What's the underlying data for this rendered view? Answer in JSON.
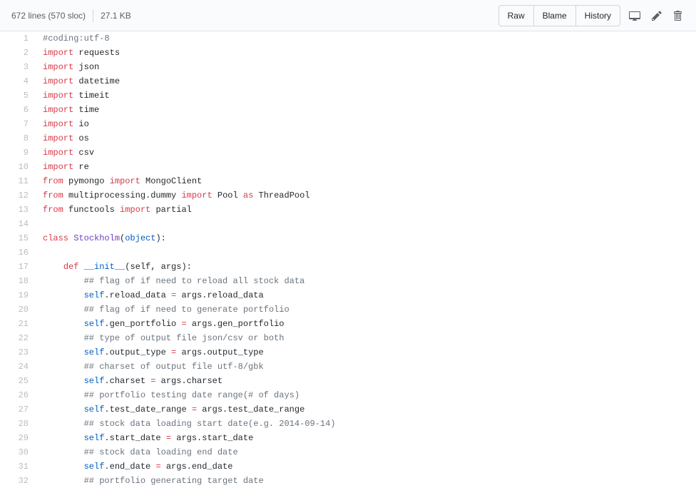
{
  "header": {
    "lines_info": "672 lines (570 sloc)",
    "size_info": "27.1 KB",
    "raw_label": "Raw",
    "blame_label": "Blame",
    "history_label": "History"
  },
  "code": {
    "lines": [
      {
        "n": 1,
        "tokens": [
          {
            "t": "#coding:utf-8",
            "c": "pl-c"
          }
        ]
      },
      {
        "n": 2,
        "tokens": [
          {
            "t": "import",
            "c": "pl-k"
          },
          {
            "t": " requests"
          }
        ]
      },
      {
        "n": 3,
        "tokens": [
          {
            "t": "import",
            "c": "pl-k"
          },
          {
            "t": " json"
          }
        ]
      },
      {
        "n": 4,
        "tokens": [
          {
            "t": "import",
            "c": "pl-k"
          },
          {
            "t": " datetime"
          }
        ]
      },
      {
        "n": 5,
        "tokens": [
          {
            "t": "import",
            "c": "pl-k"
          },
          {
            "t": " timeit"
          }
        ]
      },
      {
        "n": 6,
        "tokens": [
          {
            "t": "import",
            "c": "pl-k"
          },
          {
            "t": " time"
          }
        ]
      },
      {
        "n": 7,
        "tokens": [
          {
            "t": "import",
            "c": "pl-k"
          },
          {
            "t": " io"
          }
        ]
      },
      {
        "n": 8,
        "tokens": [
          {
            "t": "import",
            "c": "pl-k"
          },
          {
            "t": " os"
          }
        ]
      },
      {
        "n": 9,
        "tokens": [
          {
            "t": "import",
            "c": "pl-k"
          },
          {
            "t": " csv"
          }
        ]
      },
      {
        "n": 10,
        "tokens": [
          {
            "t": "import",
            "c": "pl-k"
          },
          {
            "t": " re"
          }
        ]
      },
      {
        "n": 11,
        "tokens": [
          {
            "t": "from",
            "c": "pl-k"
          },
          {
            "t": " pymongo "
          },
          {
            "t": "import",
            "c": "pl-k"
          },
          {
            "t": " MongoClient"
          }
        ]
      },
      {
        "n": 12,
        "tokens": [
          {
            "t": "from",
            "c": "pl-k"
          },
          {
            "t": " multiprocessing.dummy "
          },
          {
            "t": "import",
            "c": "pl-k"
          },
          {
            "t": " Pool "
          },
          {
            "t": "as",
            "c": "pl-k"
          },
          {
            "t": " ThreadPool"
          }
        ]
      },
      {
        "n": 13,
        "tokens": [
          {
            "t": "from",
            "c": "pl-k"
          },
          {
            "t": " functools "
          },
          {
            "t": "import",
            "c": "pl-k"
          },
          {
            "t": " partial"
          }
        ]
      },
      {
        "n": 14,
        "tokens": []
      },
      {
        "n": 15,
        "tokens": [
          {
            "t": "class",
            "c": "pl-k"
          },
          {
            "t": " "
          },
          {
            "t": "Stockholm",
            "c": "pl-en"
          },
          {
            "t": "("
          },
          {
            "t": "object",
            "c": "pl-sf"
          },
          {
            "t": "):"
          }
        ]
      },
      {
        "n": 16,
        "tokens": []
      },
      {
        "n": 17,
        "tokens": [
          {
            "t": "    "
          },
          {
            "t": "def",
            "c": "pl-k"
          },
          {
            "t": " "
          },
          {
            "t": "__init__",
            "c": "pl-sf"
          },
          {
            "t": "("
          },
          {
            "t": "self",
            "c": "pl-smi"
          },
          {
            "t": ", "
          },
          {
            "t": "args",
            "c": "pl-smi"
          },
          {
            "t": "):"
          }
        ]
      },
      {
        "n": 18,
        "tokens": [
          {
            "t": "        "
          },
          {
            "t": "## flag of if need to reload all stock data",
            "c": "pl-c"
          }
        ]
      },
      {
        "n": 19,
        "tokens": [
          {
            "t": "        "
          },
          {
            "t": "self",
            "c": "pl-sf"
          },
          {
            "t": ".reload_data "
          },
          {
            "t": "=",
            "c": "pl-k"
          },
          {
            "t": " args.reload_data"
          }
        ]
      },
      {
        "n": 20,
        "tokens": [
          {
            "t": "        "
          },
          {
            "t": "## flag of if need to generate portfolio",
            "c": "pl-c"
          }
        ]
      },
      {
        "n": 21,
        "tokens": [
          {
            "t": "        "
          },
          {
            "t": "self",
            "c": "pl-sf"
          },
          {
            "t": ".gen_portfolio "
          },
          {
            "t": "=",
            "c": "pl-k"
          },
          {
            "t": " args.gen_portfolio"
          }
        ]
      },
      {
        "n": 22,
        "tokens": [
          {
            "t": "        "
          },
          {
            "t": "## type of output file json/csv or both",
            "c": "pl-c"
          }
        ]
      },
      {
        "n": 23,
        "tokens": [
          {
            "t": "        "
          },
          {
            "t": "self",
            "c": "pl-sf"
          },
          {
            "t": ".output_type "
          },
          {
            "t": "=",
            "c": "pl-k"
          },
          {
            "t": " args.output_type"
          }
        ]
      },
      {
        "n": 24,
        "tokens": [
          {
            "t": "        "
          },
          {
            "t": "## charset of output file utf-8/gbk",
            "c": "pl-c"
          }
        ]
      },
      {
        "n": 25,
        "tokens": [
          {
            "t": "        "
          },
          {
            "t": "self",
            "c": "pl-sf"
          },
          {
            "t": ".charset "
          },
          {
            "t": "=",
            "c": "pl-k"
          },
          {
            "t": " args.charset"
          }
        ]
      },
      {
        "n": 26,
        "tokens": [
          {
            "t": "        "
          },
          {
            "t": "## portfolio testing date range(# of days)",
            "c": "pl-c"
          }
        ]
      },
      {
        "n": 27,
        "tokens": [
          {
            "t": "        "
          },
          {
            "t": "self",
            "c": "pl-sf"
          },
          {
            "t": ".test_date_range "
          },
          {
            "t": "=",
            "c": "pl-k"
          },
          {
            "t": " args.test_date_range"
          }
        ]
      },
      {
        "n": 28,
        "tokens": [
          {
            "t": "        "
          },
          {
            "t": "## stock data loading start date(e.g. 2014-09-14)",
            "c": "pl-c"
          }
        ]
      },
      {
        "n": 29,
        "tokens": [
          {
            "t": "        "
          },
          {
            "t": "self",
            "c": "pl-sf"
          },
          {
            "t": ".start_date "
          },
          {
            "t": "=",
            "c": "pl-k"
          },
          {
            "t": " args.start_date"
          }
        ]
      },
      {
        "n": 30,
        "tokens": [
          {
            "t": "        "
          },
          {
            "t": "## stock data loading end date",
            "c": "pl-c"
          }
        ]
      },
      {
        "n": 31,
        "tokens": [
          {
            "t": "        "
          },
          {
            "t": "self",
            "c": "pl-sf"
          },
          {
            "t": ".end_date "
          },
          {
            "t": "=",
            "c": "pl-k"
          },
          {
            "t": " args.end_date"
          }
        ]
      },
      {
        "n": 32,
        "tokens": [
          {
            "t": "        "
          },
          {
            "t": "## portfolio generating target date",
            "c": "pl-c"
          }
        ]
      }
    ]
  }
}
